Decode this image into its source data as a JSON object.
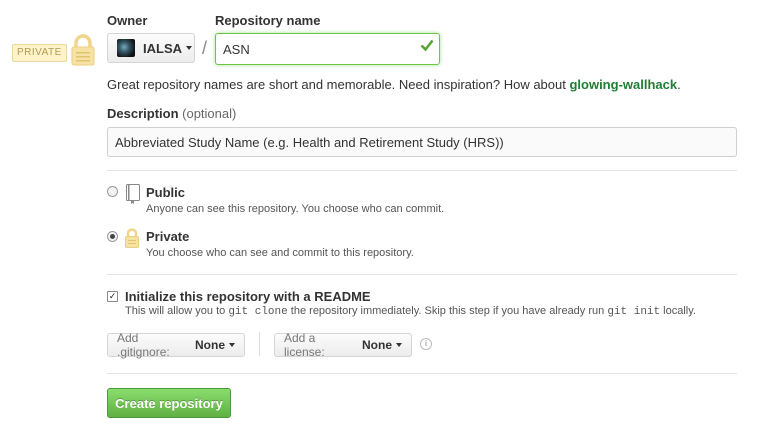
{
  "owner": {
    "label": "Owner",
    "name": "IALSA"
  },
  "repo": {
    "label": "Repository name",
    "value": "ASN",
    "separator": "/"
  },
  "private_flag": "PRIVATE",
  "hint": {
    "text": "Great repository names are short and memorable. Need inspiration? How about ",
    "suggestion": "glowing-wallhack",
    "end": "."
  },
  "description": {
    "label": "Description",
    "optional": "(optional)",
    "value": "Abbreviated Study Name (e.g. Health and Retirement Study (HRS))"
  },
  "visibility": {
    "public": {
      "title": "Public",
      "desc": "Anyone can see this repository. You choose who can commit.",
      "selected": false
    },
    "private": {
      "title": "Private",
      "desc": "You choose who can see and commit to this repository.",
      "selected": true
    }
  },
  "readme": {
    "checked": true,
    "title": "Initialize this repository with a README",
    "desc_1": "This will allow you to ",
    "code_1": "git clone",
    "desc_2": " the repository immediately. Skip this step if you have already run ",
    "code_2": "git init",
    "desc_3": " locally."
  },
  "gitignore": {
    "label": "Add .gitignore:",
    "value": "None"
  },
  "license": {
    "label": "Add a license:",
    "value": "None"
  },
  "info_icon": "i",
  "create_label": "Create repository",
  "colors": {
    "accent_green": "#6cc644",
    "button_green": "#60b044",
    "suggestion_green": "#1e7e34",
    "lock_yellow": "#f0d58a"
  }
}
